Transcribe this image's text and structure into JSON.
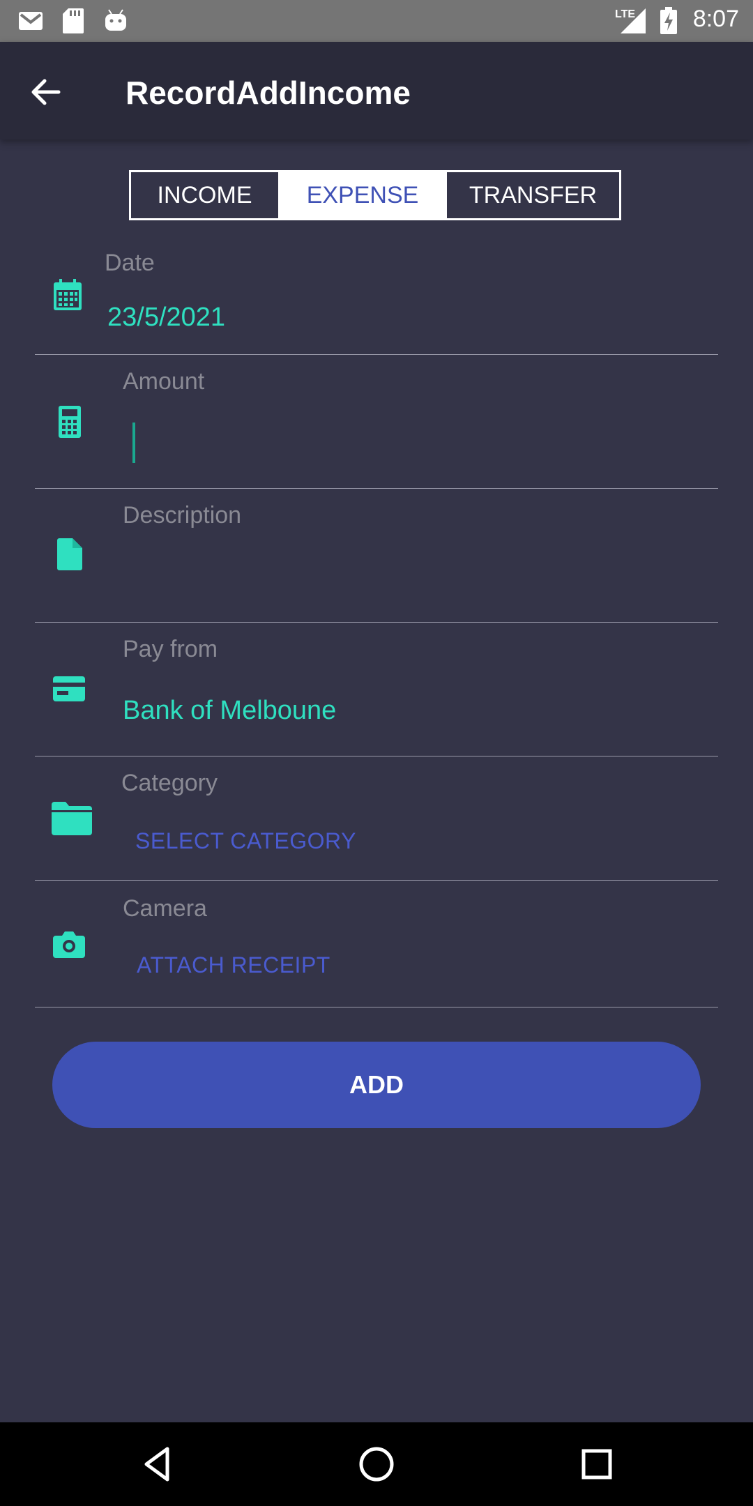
{
  "status_bar": {
    "time": "8:07",
    "network": "LTE",
    "icons": [
      "gmail-icon",
      "sd-card-icon",
      "android-icon",
      "signal-icon",
      "battery-charging-icon"
    ]
  },
  "app_bar": {
    "title": "RecordAddIncome",
    "back_icon": "arrow-back-icon"
  },
  "tabs": [
    {
      "label": "INCOME",
      "selected": false
    },
    {
      "label": "EXPENSE",
      "selected": true
    },
    {
      "label": "TRANSFER",
      "selected": false
    }
  ],
  "form": {
    "date": {
      "label": "Date",
      "value": "23/5/2021",
      "icon": "calendar-icon"
    },
    "amount": {
      "label": "Amount",
      "value": "",
      "icon": "calculator-icon"
    },
    "description": {
      "label": "Description",
      "value": "",
      "icon": "document-icon"
    },
    "pay_from": {
      "label": "Pay from",
      "value": "Bank of Melboune",
      "icon": "credit-card-icon"
    },
    "category": {
      "label": "Category",
      "action": "SELECT CATEGORY",
      "icon": "folder-icon"
    },
    "camera": {
      "label": "Camera",
      "action": "ATTACH RECEIPT",
      "icon": "camera-icon"
    }
  },
  "add_button": {
    "label": "ADD"
  },
  "colors": {
    "background": "#343448",
    "app_bar": "#2a2a3a",
    "accent": "#2fe0c0",
    "primary": "#3f51b5",
    "label": "#8a8a94"
  },
  "nav_bar": {
    "icons": [
      "back-triangle-icon",
      "home-circle-icon",
      "recents-square-icon"
    ]
  }
}
